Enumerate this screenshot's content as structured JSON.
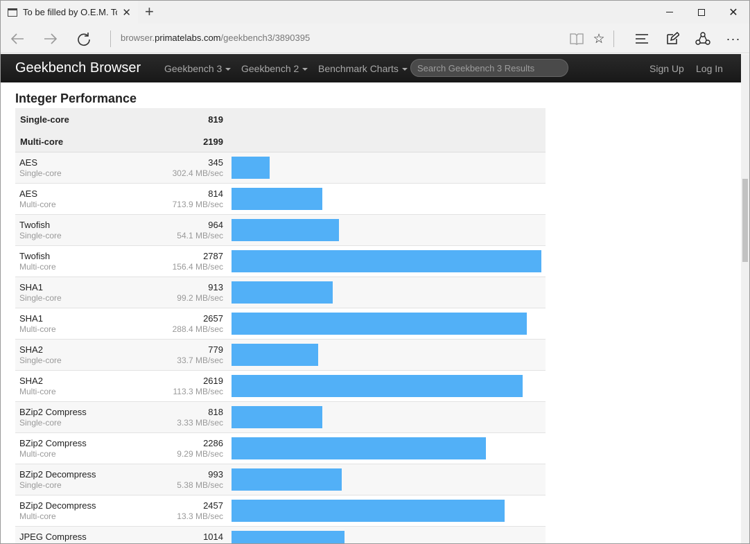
{
  "browser": {
    "tab_title": "To be filled by O.E.M. To",
    "address_prefix": "browser.",
    "address_domain": "primatelabs.com",
    "address_path": "/geekbench3/3890395"
  },
  "site": {
    "brand": "Geekbench Browser",
    "nav": {
      "gb3": "Geekbench 3",
      "gb2": "Geekbench 2",
      "charts": "Benchmark Charts",
      "search_placeholder": "Search Geekbench 3 Results",
      "signup": "Sign Up",
      "login": "Log In"
    }
  },
  "colors": {
    "bar": "#52b0f7",
    "header_bg": "#1e1e1e"
  },
  "section": {
    "title": "Integer Performance",
    "summary": [
      {
        "label": "Single-core",
        "value": "819"
      },
      {
        "label": "Multi-core",
        "value": "2199"
      }
    ],
    "max_score": 2787,
    "rows": [
      {
        "name": "AES",
        "mode": "Single-core",
        "score": 345,
        "rate": "302.4 MB/sec"
      },
      {
        "name": "AES",
        "mode": "Multi-core",
        "score": 814,
        "rate": "713.9 MB/sec"
      },
      {
        "name": "Twofish",
        "mode": "Single-core",
        "score": 964,
        "rate": "54.1 MB/sec"
      },
      {
        "name": "Twofish",
        "mode": "Multi-core",
        "score": 2787,
        "rate": "156.4 MB/sec"
      },
      {
        "name": "SHA1",
        "mode": "Single-core",
        "score": 913,
        "rate": "99.2 MB/sec"
      },
      {
        "name": "SHA1",
        "mode": "Multi-core",
        "score": 2657,
        "rate": "288.4 MB/sec"
      },
      {
        "name": "SHA2",
        "mode": "Single-core",
        "score": 779,
        "rate": "33.7 MB/sec"
      },
      {
        "name": "SHA2",
        "mode": "Multi-core",
        "score": 2619,
        "rate": "113.3 MB/sec"
      },
      {
        "name": "BZip2 Compress",
        "mode": "Single-core",
        "score": 818,
        "rate": "3.33 MB/sec"
      },
      {
        "name": "BZip2 Compress",
        "mode": "Multi-core",
        "score": 2286,
        "rate": "9.29 MB/sec"
      },
      {
        "name": "BZip2 Decompress",
        "mode": "Single-core",
        "score": 993,
        "rate": "5.38 MB/sec"
      },
      {
        "name": "BZip2 Decompress",
        "mode": "Multi-core",
        "score": 2457,
        "rate": "13.3 MB/sec"
      },
      {
        "name": "JPEG Compress",
        "mode": "",
        "score": 1014,
        "rate": ""
      }
    ]
  }
}
